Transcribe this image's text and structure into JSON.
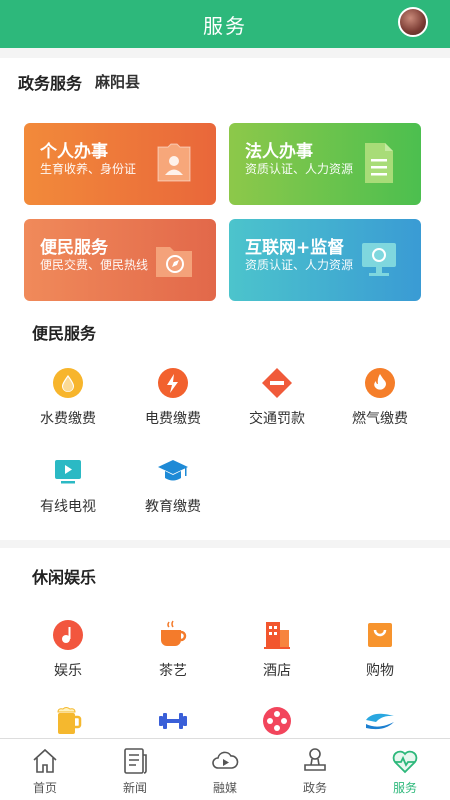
{
  "header": {
    "title": "服务"
  },
  "gov": {
    "title": "政务服务",
    "region": "麻阳县",
    "cards": [
      {
        "title": "个人办事",
        "sub": "生育收养、身份证"
      },
      {
        "title": "法人办事",
        "sub": "资质认证、人力资源"
      },
      {
        "title": "便民服务",
        "sub": "便民交费、便民热线"
      },
      {
        "title": "互联网+监督",
        "sub": "资质认证、人力资源"
      }
    ]
  },
  "services": {
    "title": "便民服务",
    "items": [
      {
        "label": "水费缴费",
        "icon": "water-drop-icon"
      },
      {
        "label": "电费缴费",
        "icon": "lightning-icon"
      },
      {
        "label": "交通罚款",
        "icon": "no-entry-icon"
      },
      {
        "label": "燃气缴费",
        "icon": "flame-icon"
      },
      {
        "label": "有线电视",
        "icon": "tv-icon"
      },
      {
        "label": "教育缴费",
        "icon": "graduation-cap-icon"
      }
    ]
  },
  "leisure": {
    "title": "休闲娱乐",
    "items": [
      {
        "label": "娱乐",
        "icon": "music-note-icon"
      },
      {
        "label": "茶艺",
        "icon": "tea-cup-icon"
      },
      {
        "label": "酒店",
        "icon": "hotel-building-icon"
      },
      {
        "label": "购物",
        "icon": "shopping-bag-icon"
      },
      {
        "label": "",
        "icon": "beer-mug-icon"
      },
      {
        "label": "",
        "icon": "dumbbell-icon"
      },
      {
        "label": "",
        "icon": "film-reel-icon"
      },
      {
        "label": "",
        "icon": "water-wave-icon"
      }
    ]
  },
  "tabbar": {
    "tabs": [
      {
        "label": "首页",
        "icon": "home-icon"
      },
      {
        "label": "新闻",
        "icon": "news-icon"
      },
      {
        "label": "融媒",
        "icon": "cloud-play-icon"
      },
      {
        "label": "政务",
        "icon": "stamp-icon"
      },
      {
        "label": "服务",
        "icon": "heart-icon"
      }
    ],
    "active_index": 4
  },
  "colors": {
    "primary": "#2db87b"
  }
}
